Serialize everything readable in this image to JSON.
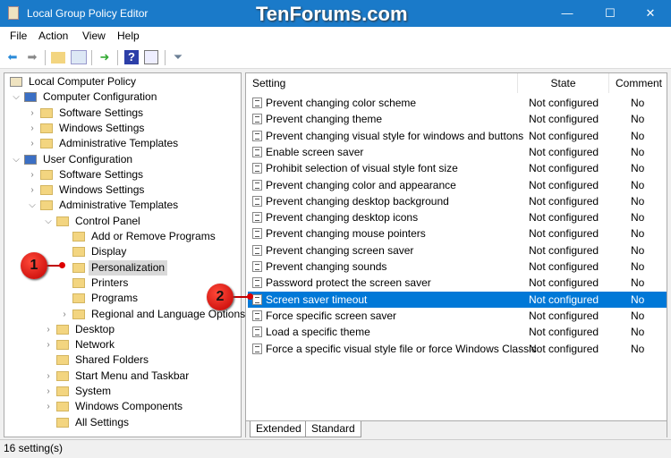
{
  "window": {
    "title": "Local Group Policy Editor",
    "watermark": "TenForums.com",
    "controls": {
      "minimize": "—",
      "maximize": "☐",
      "close": "✕"
    }
  },
  "menu": [
    "File",
    "Action",
    "View",
    "Help"
  ],
  "toolbar": [
    "back-icon",
    "forward-icon",
    "up-folder-icon",
    "show-hide-tree-icon",
    "export-icon",
    "help-icon",
    "properties-icon",
    "filter-icon"
  ],
  "tree": [
    {
      "label": "Local Computer Policy",
      "level": 0,
      "arrow": ""
    },
    {
      "label": "Computer Configuration",
      "level": 1,
      "arrow": "expanded"
    },
    {
      "label": "Software Settings",
      "level": 2,
      "arrow": "collapsed"
    },
    {
      "label": "Windows Settings",
      "level": 2,
      "arrow": "collapsed"
    },
    {
      "label": "Administrative Templates",
      "level": 2,
      "arrow": "collapsed"
    },
    {
      "label": "User Configuration",
      "level": 1,
      "arrow": "expanded"
    },
    {
      "label": "Software Settings",
      "level": 2,
      "arrow": "collapsed"
    },
    {
      "label": "Windows Settings",
      "level": 2,
      "arrow": "collapsed"
    },
    {
      "label": "Administrative Templates",
      "level": 2,
      "arrow": "expanded"
    },
    {
      "label": "Control Panel",
      "level": 3,
      "arrow": "expanded"
    },
    {
      "label": "Add or Remove Programs",
      "level": 4,
      "arrow": ""
    },
    {
      "label": "Display",
      "level": 4,
      "arrow": ""
    },
    {
      "label": "Personalization",
      "level": 4,
      "arrow": "",
      "selected": true
    },
    {
      "label": "Printers",
      "level": 4,
      "arrow": ""
    },
    {
      "label": "Programs",
      "level": 4,
      "arrow": ""
    },
    {
      "label": "Regional and Language Options",
      "level": 4,
      "arrow": "collapsed"
    },
    {
      "label": "Desktop",
      "level": 3,
      "arrow": "collapsed"
    },
    {
      "label": "Network",
      "level": 3,
      "arrow": "collapsed"
    },
    {
      "label": "Shared Folders",
      "level": 3,
      "arrow": ""
    },
    {
      "label": "Start Menu and Taskbar",
      "level": 3,
      "arrow": "collapsed"
    },
    {
      "label": "System",
      "level": 3,
      "arrow": "collapsed"
    },
    {
      "label": "Windows Components",
      "level": 3,
      "arrow": "collapsed"
    },
    {
      "label": "All Settings",
      "level": 3,
      "arrow": ""
    }
  ],
  "columns": {
    "setting": "Setting",
    "state": "State",
    "comment": "Comment"
  },
  "settings": [
    {
      "name": "Prevent changing color scheme",
      "state": "Not configured",
      "comment": "No"
    },
    {
      "name": "Prevent changing theme",
      "state": "Not configured",
      "comment": "No"
    },
    {
      "name": "Prevent changing visual style for windows and buttons",
      "state": "Not configured",
      "comment": "No"
    },
    {
      "name": "Enable screen saver",
      "state": "Not configured",
      "comment": "No"
    },
    {
      "name": "Prohibit selection of visual style font size",
      "state": "Not configured",
      "comment": "No"
    },
    {
      "name": "Prevent changing color and appearance",
      "state": "Not configured",
      "comment": "No"
    },
    {
      "name": "Prevent changing desktop background",
      "state": "Not configured",
      "comment": "No"
    },
    {
      "name": "Prevent changing desktop icons",
      "state": "Not configured",
      "comment": "No"
    },
    {
      "name": "Prevent changing mouse pointers",
      "state": "Not configured",
      "comment": "No"
    },
    {
      "name": "Prevent changing screen saver",
      "state": "Not configured",
      "comment": "No"
    },
    {
      "name": "Prevent changing sounds",
      "state": "Not configured",
      "comment": "No"
    },
    {
      "name": "Password protect the screen saver",
      "state": "Not configured",
      "comment": "No"
    },
    {
      "name": "Screen saver timeout",
      "state": "Not configured",
      "comment": "No",
      "selected": true
    },
    {
      "name": "Force specific screen saver",
      "state": "Not configured",
      "comment": "No"
    },
    {
      "name": "Load a specific theme",
      "state": "Not configured",
      "comment": "No"
    },
    {
      "name": "Force a specific visual style file or force Windows Classic",
      "state": "Not configured",
      "comment": "No"
    }
  ],
  "tabs": [
    "Extended",
    "Standard"
  ],
  "status": "16 setting(s)",
  "callouts": [
    "1",
    "2"
  ],
  "colors": {
    "titlebar": "#1a7ac9",
    "selection": "#0078d7",
    "callout": "#d00000"
  }
}
